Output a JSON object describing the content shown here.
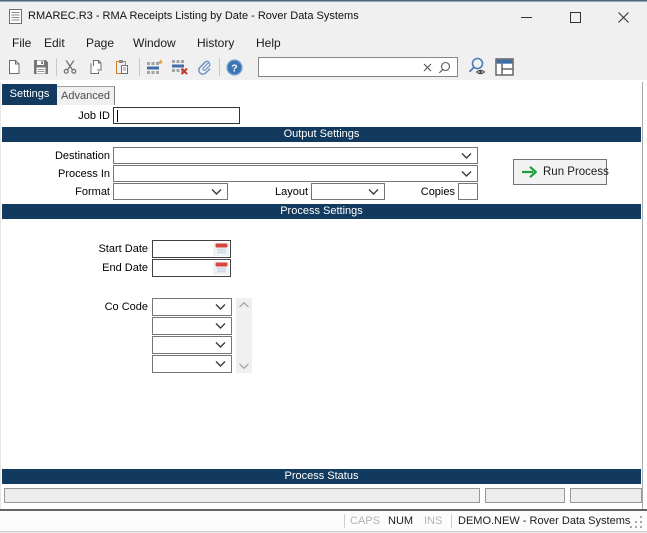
{
  "window": {
    "title": "RMAREC.R3 - RMA Receipts Listing by Date - Rover Data Systems",
    "controls": {
      "minimize": "minimize",
      "maximize": "maximize",
      "close": "close"
    }
  },
  "menu": {
    "items": [
      {
        "label": "File"
      },
      {
        "label": "Edit"
      },
      {
        "label": "Page"
      },
      {
        "label": "Window"
      },
      {
        "label": "History"
      },
      {
        "label": "Help"
      }
    ]
  },
  "toolbar": {
    "icons": [
      "new-document",
      "save",
      "cut",
      "copy",
      "paste",
      "insert-row",
      "delete-row",
      "attachment",
      "help",
      "find-view",
      "grid-view"
    ],
    "search": {
      "value": ""
    }
  },
  "tabs": [
    {
      "label": "Settings",
      "active": true
    },
    {
      "label": "Advanced",
      "active": false
    }
  ],
  "form": {
    "job_id": {
      "label": "Job ID",
      "value": ""
    },
    "sections": {
      "output": "Output Settings",
      "process": "Process Settings",
      "status": "Process Status"
    },
    "fields": {
      "destination": {
        "label": "Destination",
        "value": ""
      },
      "process_in": {
        "label": "Process In",
        "value": ""
      },
      "format": {
        "label": "Format",
        "value": ""
      },
      "layout": {
        "label": "Layout",
        "value": ""
      },
      "copies": {
        "label": "Copies",
        "value": ""
      },
      "start_date": {
        "label": "Start Date",
        "value": ""
      },
      "end_date": {
        "label": "End Date",
        "value": ""
      },
      "co_code": {
        "label": "Co Code",
        "values": [
          "",
          "",
          "",
          ""
        ]
      }
    },
    "run_button": {
      "label": "Run Process"
    }
  },
  "statusbar": {
    "caps": "CAPS",
    "num": "NUM",
    "ins": "INS",
    "connection": "DEMO.NEW - Rover Data Systems"
  },
  "colors": {
    "navy": "#123a5e",
    "chrome": "#f0f0f0",
    "run_arrow_green": "#1d9e3d",
    "calendar_red": "#d9453c",
    "help_blue": "#3a76b4"
  }
}
